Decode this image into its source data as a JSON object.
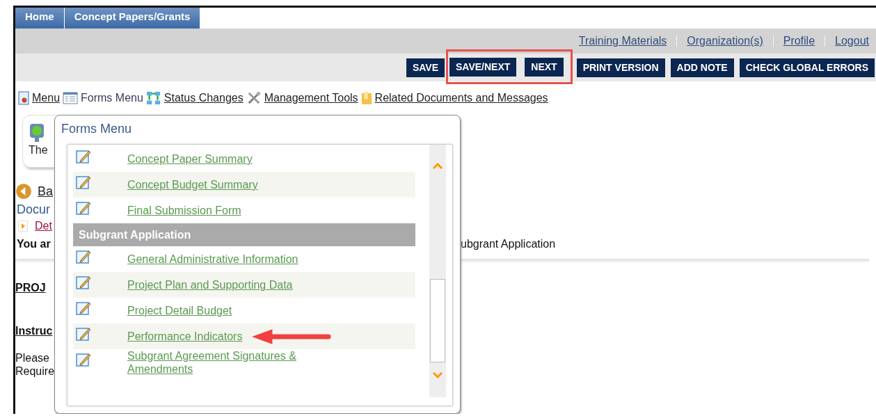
{
  "tabs": [
    {
      "label": "Home"
    },
    {
      "label": "Concept Papers/Grants"
    }
  ],
  "top_links": [
    "Training Materials",
    "Organization(s)",
    "Profile",
    "Logout"
  ],
  "buttons": [
    {
      "label": "SAVE",
      "highlighted": false
    },
    {
      "label": "SAVE/NEXT",
      "highlighted": true
    },
    {
      "label": "NEXT",
      "highlighted": true
    },
    {
      "label": "PRINT VERSION",
      "highlighted": false
    },
    {
      "label": "ADD NOTE",
      "highlighted": false
    },
    {
      "label": "CHECK GLOBAL ERRORS",
      "highlighted": false
    }
  ],
  "toolbar": [
    {
      "label": "Menu",
      "selected": false
    },
    {
      "label": "Forms Menu",
      "selected": true
    },
    {
      "label": "Status Changes",
      "selected": false
    },
    {
      "label": "Management Tools",
      "selected": false
    },
    {
      "label": "Related Documents and Messages",
      "selected": false
    }
  ],
  "status_box": {
    "text": "The"
  },
  "back_link": "Ba",
  "document_heading": "Docur",
  "detail_link": "Det",
  "context_line": {
    "prefix": "You ar",
    "suffix": "ubgrant Application"
  },
  "section_title": "PROJ",
  "instructions_label": "Instruc",
  "body_lines": [
    "Please",
    "Require"
  ],
  "forms_menu": {
    "title": "Forms Menu",
    "rows": [
      {
        "kind": "item",
        "label": "Concept Paper Summary",
        "pointed": false
      },
      {
        "kind": "item",
        "label": "Concept Budget Summary",
        "pointed": false
      },
      {
        "kind": "item",
        "label": "Final Submission Form",
        "pointed": false
      },
      {
        "kind": "section",
        "label": "Subgrant Application"
      },
      {
        "kind": "item",
        "label": "General Administrative Information",
        "pointed": false
      },
      {
        "kind": "item",
        "label": "Project Plan and Supporting Data",
        "pointed": false
      },
      {
        "kind": "item",
        "label": "Project Detail Budget",
        "pointed": false
      },
      {
        "kind": "item",
        "label": "Performance Indicators",
        "pointed": true
      },
      {
        "kind": "item",
        "label": "Subgrant Agreement Signatures & Amendments",
        "pointed": false
      }
    ]
  }
}
